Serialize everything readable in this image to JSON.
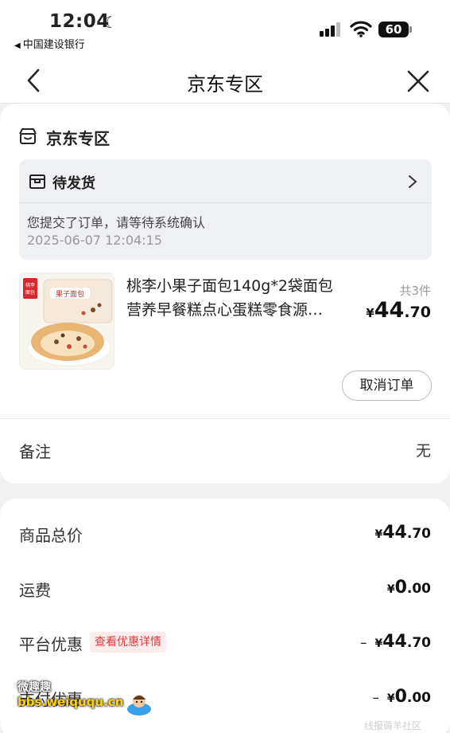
{
  "status_bar": {
    "time": "12:04",
    "back_app": "中国建设银行",
    "battery": "60"
  },
  "nav": {
    "title": "京东专区"
  },
  "order": {
    "shop_name": "京东专区",
    "status_title": "待发货",
    "status_message": "您提交了订单，请等待系统确认",
    "status_time": "2025-06-07 12:04:15",
    "product": {
      "name_line1": "桃李小果子面包140g*2袋面包",
      "name_line2": "营养早餐糕点心蛋糕零食源…",
      "thumb_brand": "桃李面包",
      "thumb_label": "果子面包",
      "quantity": "共3件",
      "price_symbol": "¥",
      "price_int": "44",
      "price_dec": ".70"
    },
    "cancel_button": "取消订单",
    "note_label": "备注",
    "note_value": "无"
  },
  "summary": {
    "goods_total_label": "商品总价",
    "goods_total": {
      "symbol": "¥",
      "int": "44",
      "dec": ".70"
    },
    "shipping_label": "运费",
    "shipping": {
      "symbol": "¥",
      "int": "0",
      "dec": ".00"
    },
    "platform_discount_label": "平台优惠",
    "platform_discount_link": "查看优惠详情",
    "platform_discount": {
      "minus": "–",
      "symbol": "¥",
      "int": "44",
      "dec": ".70"
    },
    "payment_discount_label": "支付优惠",
    "payment_discount": {
      "minus": "–",
      "symbol": "¥",
      "int": "0",
      "dec": ".00"
    }
  },
  "watermark": {
    "title": "微趣趣",
    "site": "bbs.weiququ.cn",
    "right_text": "线报薅羊社区"
  }
}
